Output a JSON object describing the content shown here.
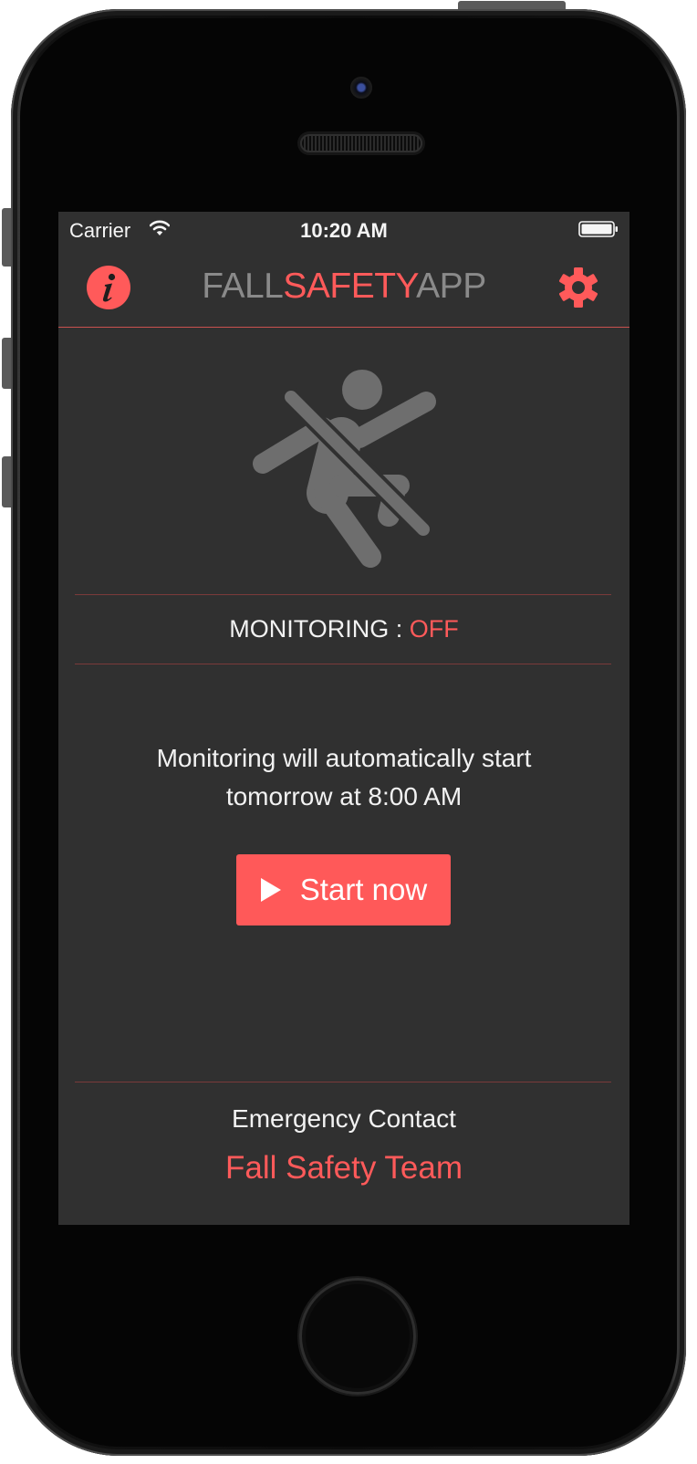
{
  "status_bar": {
    "carrier": "Carrier",
    "time": "10:20 AM"
  },
  "header": {
    "title_parts": [
      "FALL",
      "SAFETY",
      "APP"
    ],
    "left_icon": "info-icon",
    "right_icon": "gear-icon"
  },
  "hero": {
    "icon": "fall-prohibited-icon"
  },
  "monitoring": {
    "label": "MONITORING : ",
    "value": "OFF"
  },
  "schedule": {
    "message_line1": "Monitoring will automatically start",
    "message_line2": "tomorrow at 8:00 AM"
  },
  "start_button": {
    "icon": "play-icon",
    "label": "Start now"
  },
  "emergency": {
    "label": "Emergency Contact",
    "contact": "Fall Safety Team"
  },
  "colors": {
    "accent": "#ff5a5a",
    "screen_background": "#303030",
    "muted_text": "#8a8a8a",
    "icon_gray": "#6e6e6e"
  }
}
